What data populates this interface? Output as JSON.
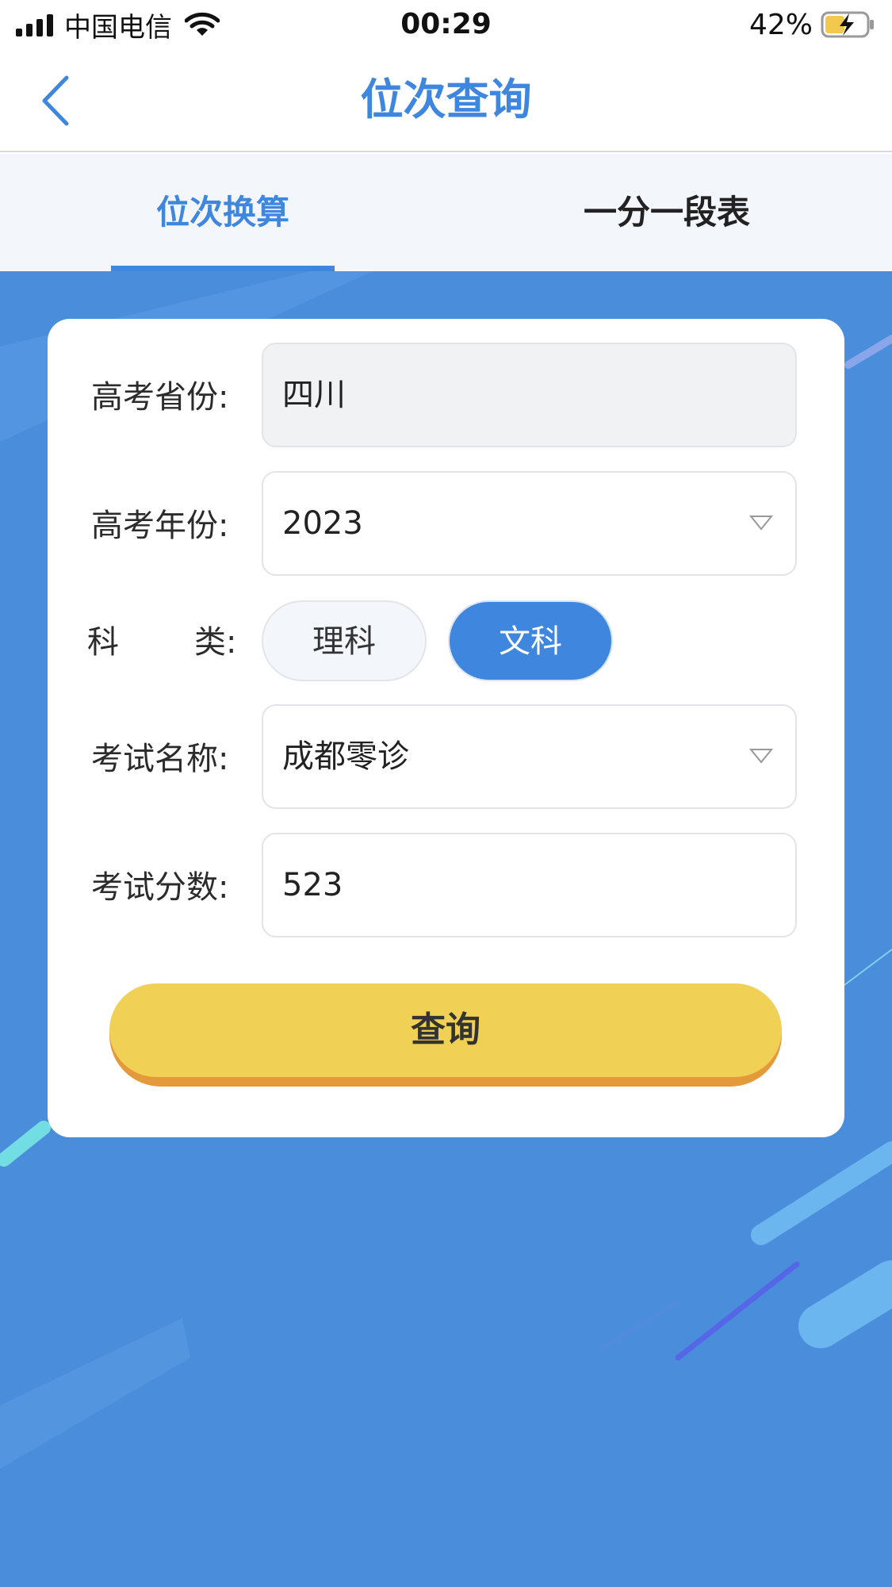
{
  "status_bar": {
    "carrier": "中国电信",
    "time": "00:29",
    "battery": "42%"
  },
  "nav": {
    "title": "位次查询"
  },
  "tabs": [
    {
      "label": "位次换算",
      "active": true
    },
    {
      "label": "一分一段表",
      "active": false
    }
  ],
  "form": {
    "province": {
      "label": "高考省份:",
      "value": "四川"
    },
    "year": {
      "label": "高考年份:",
      "value": "2023"
    },
    "subject": {
      "label_left": "科",
      "label_right": "类:",
      "options": [
        "理科",
        "文科"
      ],
      "selected": "文科"
    },
    "exam_name": {
      "label": "考试名称:",
      "value": "成都零诊"
    },
    "score": {
      "label": "考试分数:",
      "value": "523"
    }
  },
  "query_button": {
    "label": "查询"
  },
  "colors": {
    "accent": "#3f87de",
    "background_blue": "#4a8edb",
    "button_yellow": "#f0d155",
    "button_shadow": "#e4993a"
  }
}
